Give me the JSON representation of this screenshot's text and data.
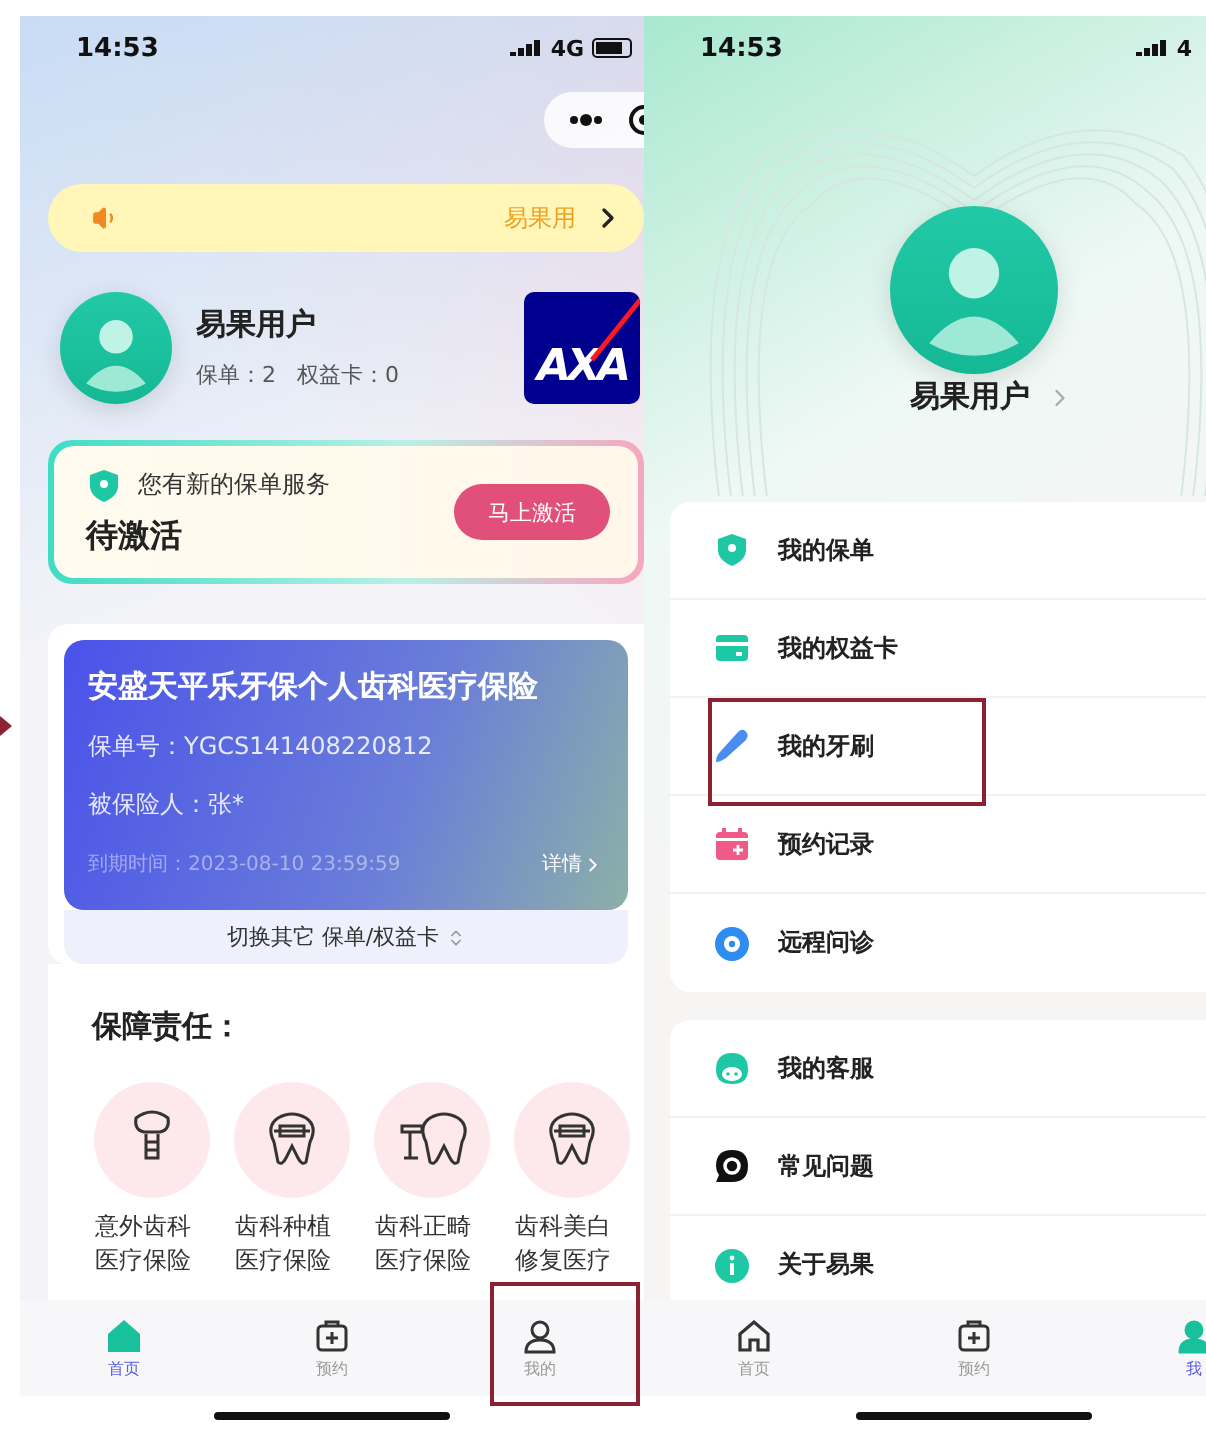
{
  "left_screen": {
    "status_bar": {
      "time": "14:53",
      "network": "4G"
    },
    "notice": {
      "text": "易果用"
    },
    "user": {
      "name": "易果用户",
      "stats": "保单：2   权益卡：0",
      "logo": "AXA"
    },
    "service_card": {
      "title": "您有新的保单服务",
      "status": "待激活",
      "button": "马上激活"
    },
    "policy_card": {
      "name": "安盛天平乐牙保个人齿科医疗保险",
      "number": "保单号：YGCS141408220812",
      "insured": "被保险人：张*",
      "expiry": "到期时间：2023-08-10 23:59:59",
      "details": "详情",
      "switch": "切换其它 保单/权益卡"
    },
    "coverage": {
      "title": "保障责任：",
      "items": [
        {
          "kind": "implant",
          "label": "意外齿科医疗保险"
        },
        {
          "kind": "braces",
          "label": "齿科种植医疗保险"
        },
        {
          "kind": "drill",
          "label": "齿科正畸医疗保险"
        },
        {
          "kind": "braces",
          "label": "齿科美白修复医疗"
        }
      ]
    },
    "tab_bar": [
      {
        "kind": "home",
        "label": "首页",
        "selected": true,
        "highlighted": false
      },
      {
        "kind": "booking",
        "label": "预约",
        "selected": false,
        "highlighted": false
      },
      {
        "kind": "profile",
        "label": "我的",
        "selected": false,
        "highlighted": true
      }
    ]
  },
  "right_screen": {
    "status_bar": {
      "time": "14:53",
      "network": "4"
    },
    "user": {
      "name": "易果用户"
    },
    "menu_groups": [
      [
        {
          "kind": "policy",
          "label": "我的保单",
          "highlighted": false
        },
        {
          "kind": "card",
          "label": "我的权益卡",
          "highlighted": false
        },
        {
          "kind": "toothbrush",
          "label": "我的牙刷",
          "highlighted": true
        },
        {
          "kind": "calendar",
          "label": "预约记录",
          "highlighted": false
        },
        {
          "kind": "consult",
          "label": "远程问诊",
          "highlighted": false
        }
      ],
      [
        {
          "kind": "service",
          "label": "我的客服",
          "highlighted": false
        },
        {
          "kind": "faq",
          "label": "常见问题",
          "highlighted": false
        },
        {
          "kind": "about",
          "label": "关于易果",
          "highlighted": false
        }
      ]
    ],
    "tab_bar": [
      {
        "kind": "home",
        "label": "首页",
        "selected": false,
        "highlighted": false
      },
      {
        "kind": "booking",
        "label": "预约",
        "selected": false,
        "highlighted": false
      },
      {
        "kind": "profile",
        "label": "我",
        "selected": true,
        "highlighted": false
      }
    ]
  }
}
